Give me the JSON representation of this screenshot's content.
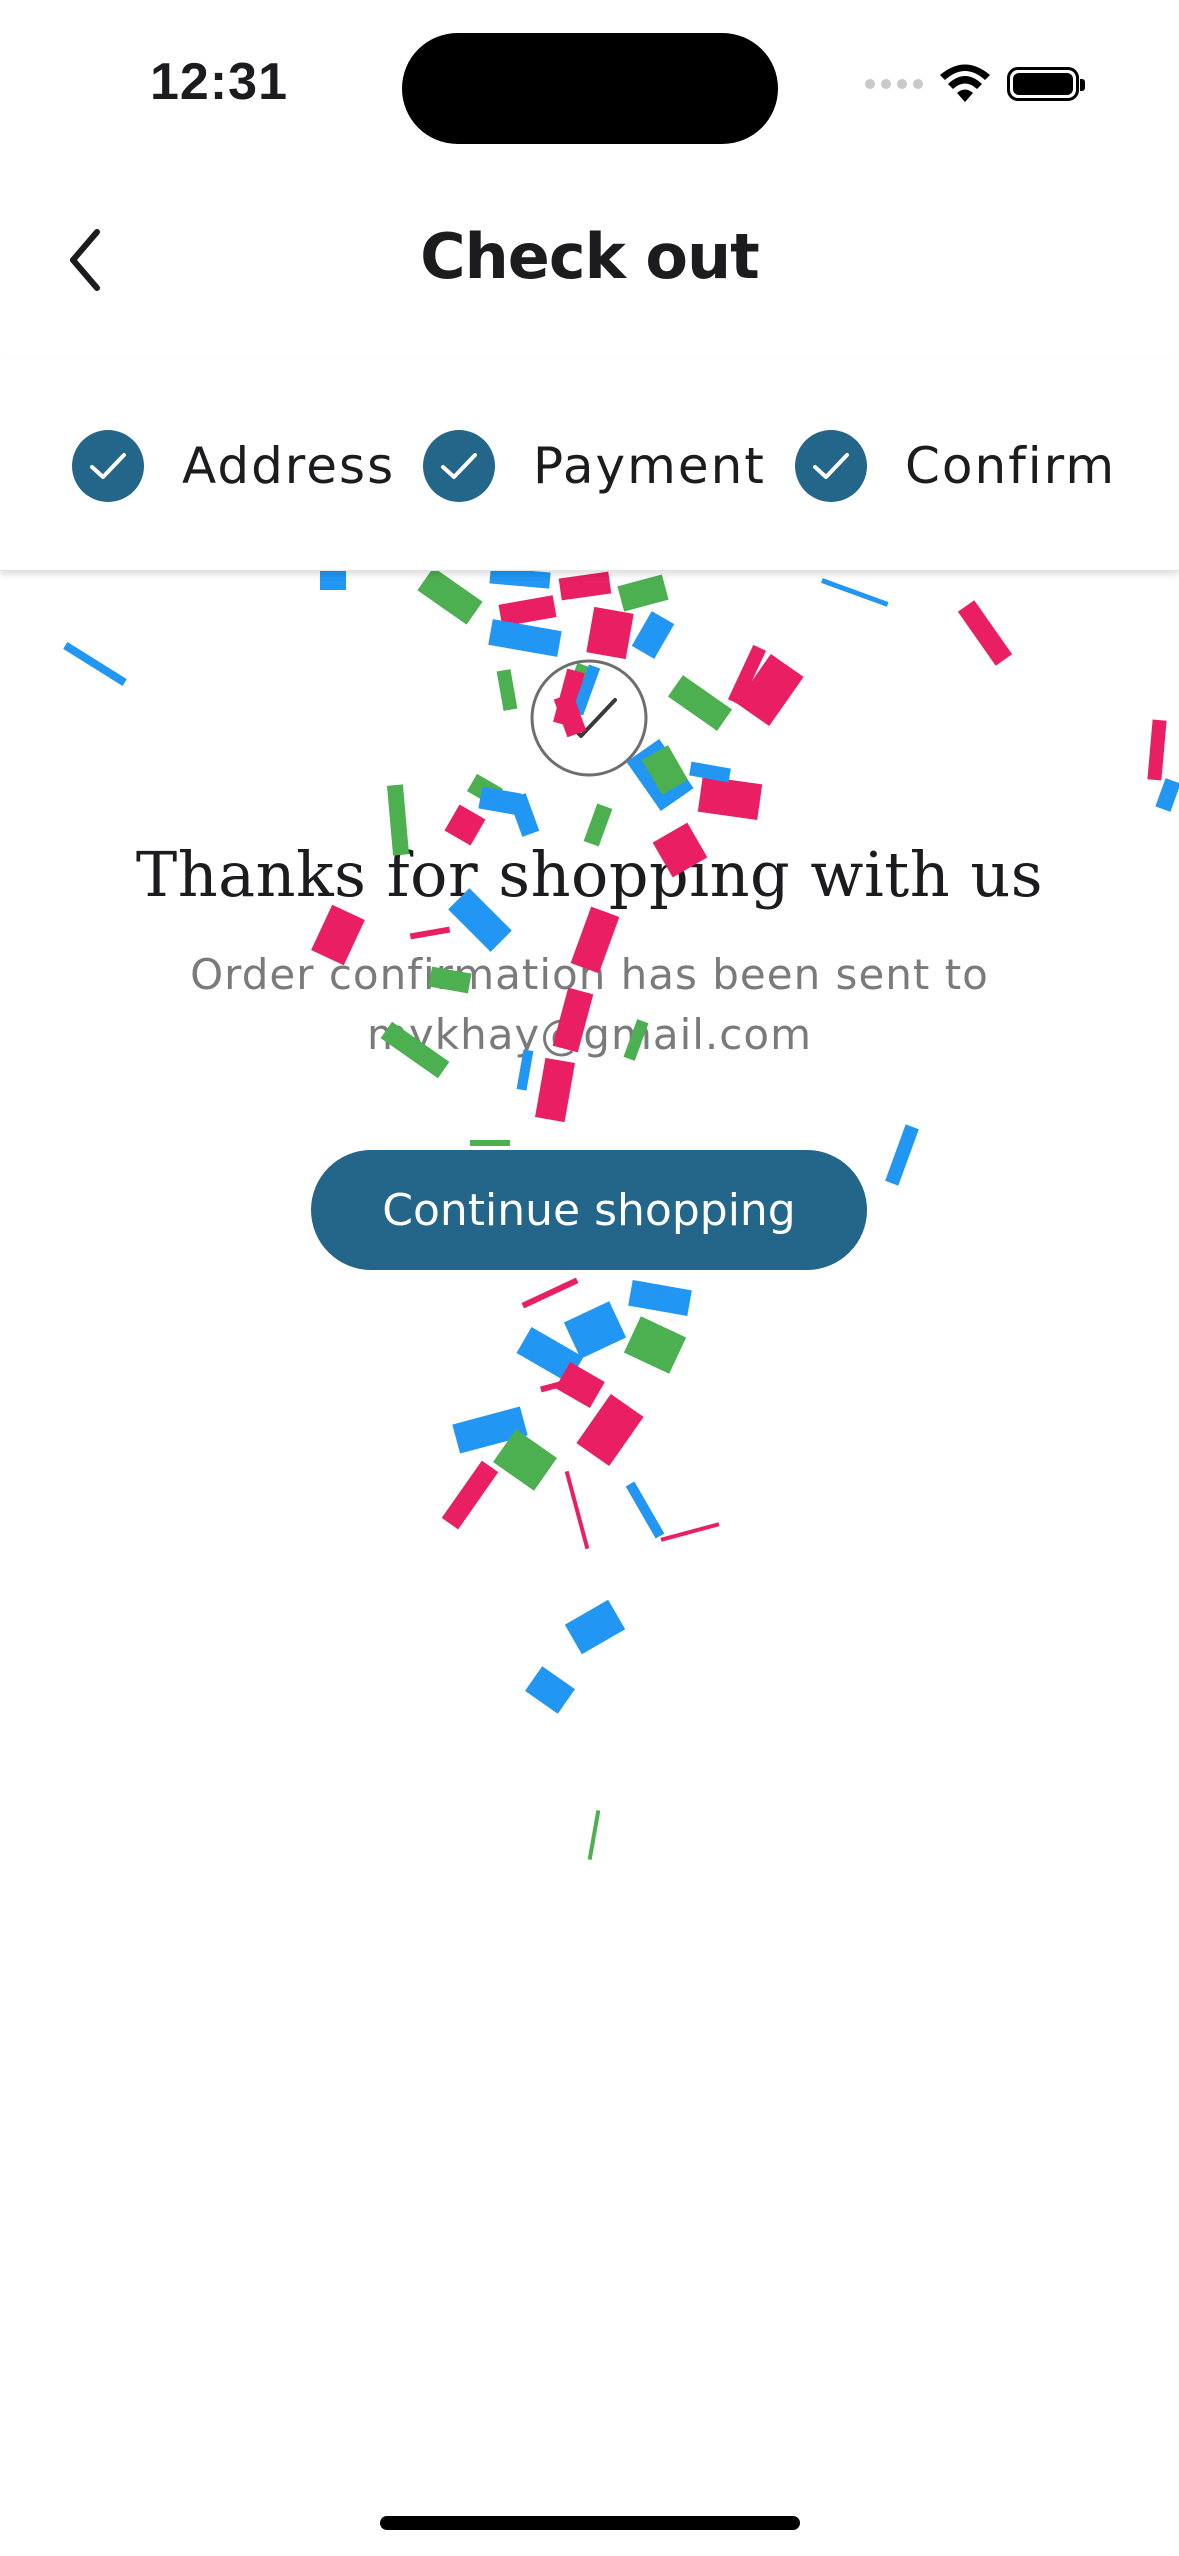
{
  "status_bar": {
    "time": "12:31",
    "icons": [
      "cellular-signal-icon",
      "wifi-icon",
      "battery-icon"
    ]
  },
  "header": {
    "title": "Check out",
    "back_icon": "chevron-left-icon"
  },
  "stepper": {
    "steps": [
      {
        "label": "Address",
        "completed": true
      },
      {
        "label": "Payment",
        "completed": true
      },
      {
        "label": "Confirm",
        "completed": true
      }
    ]
  },
  "confirmation": {
    "icon": "check-circle-icon",
    "heading": "Thanks for shopping with us",
    "message_line1": "Order confirmation has been sent to",
    "message_line2": "mykhay@gmail.com",
    "button_label": "Continue shopping"
  },
  "colors": {
    "accent": "#24658a",
    "confetti_pink": "#e91e63",
    "confetti_blue": "#2196f3",
    "confetti_green": "#4caf50"
  }
}
